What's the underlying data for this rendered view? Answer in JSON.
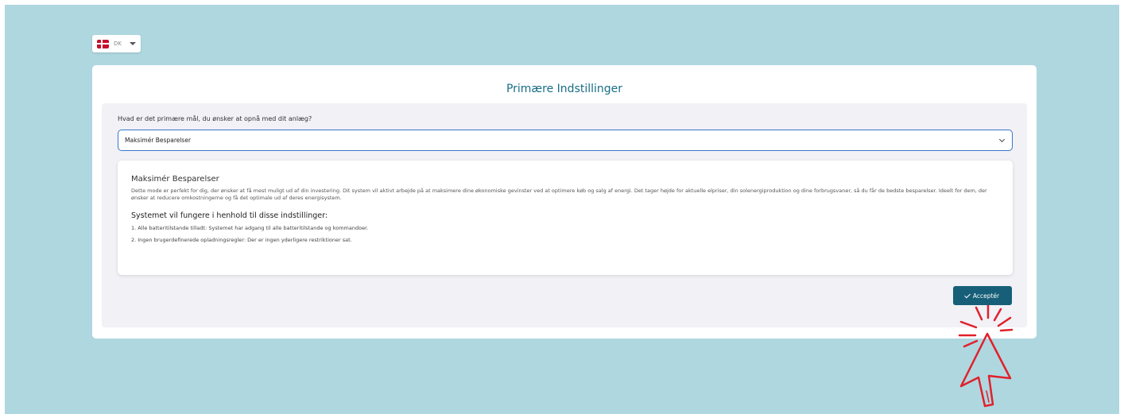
{
  "language": {
    "code": "DK",
    "flag": "danish-flag-icon"
  },
  "page": {
    "title": "Primære Indstillinger"
  },
  "form": {
    "question": "Hvad er det primære mål, du ønsker at opnå med dit anlæg?",
    "selected": "Maksimér Besparelser"
  },
  "info": {
    "title": "Maksimér Besparelser",
    "description": "Dette mode er perfekt for dig, der ønsker at få mest muligt ud af din investering. Dit system vil aktivt arbejde på at maksimere dine økonomiske gevinster ved at optimere køb og salg af energi. Det tager højde for aktuelle elpriser, din solenergiproduktion og dine forbrugsvaner, så du får de bedste besparelser. Ideelt for dem, der ønsker at reducere omkostningerne og få det optimale ud af deres energisystem.",
    "subtitle": "Systemet vil fungere i henhold til disse indstillinger:",
    "rules": [
      "1. Alle batteritilstande tilladt: Systemet har adgang til alle batteritilstande og kommandoer.",
      "2. Ingen brugerdefinerede opladningsregler: Der er ingen yderligere restriktioner sat."
    ]
  },
  "actions": {
    "accept_label": "Acceptér"
  },
  "colors": {
    "accent": "#175f78",
    "title": "#186e86",
    "background": "#afd7e0",
    "pointer": "#e0212b"
  }
}
